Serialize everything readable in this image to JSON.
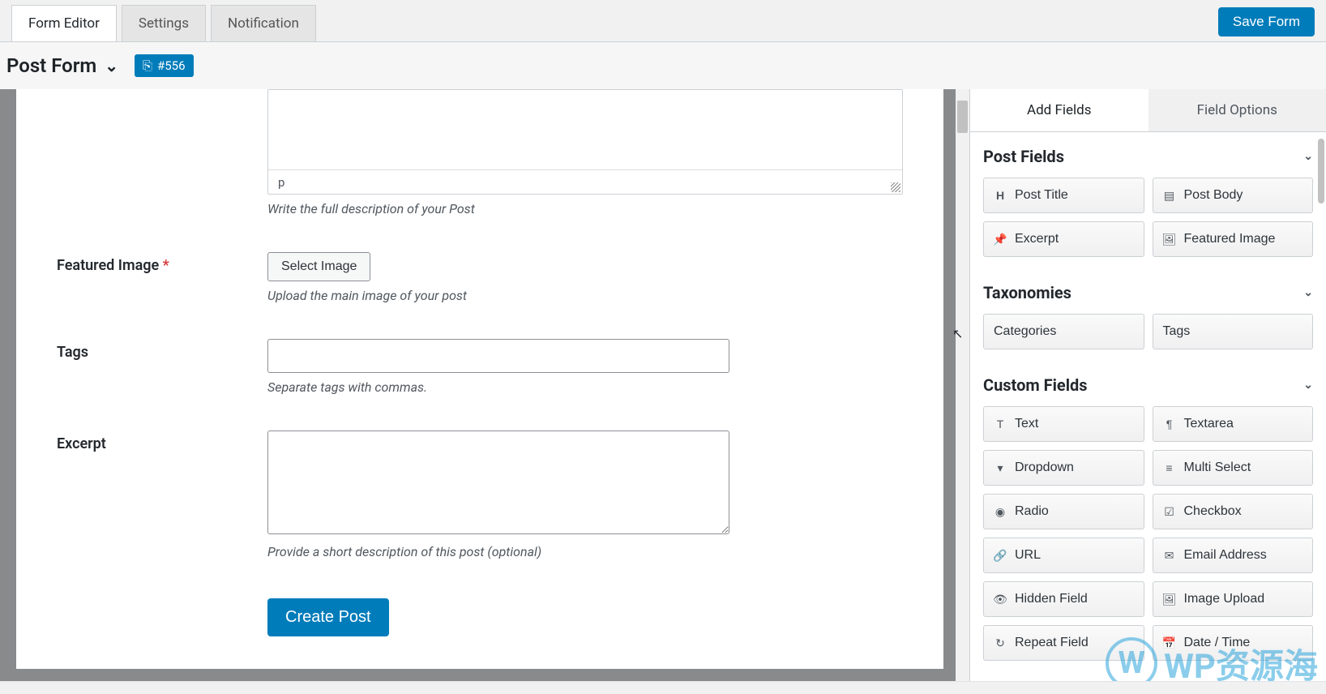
{
  "topbar": {
    "tabs": [
      "Form Editor",
      "Settings",
      "Notification"
    ],
    "save": "Save Form"
  },
  "subbar": {
    "title": "Post Form",
    "badge": "#556"
  },
  "form": {
    "rte_path": "p",
    "rte_help": "Write the full description of your Post",
    "featured": {
      "label": "Featured Image",
      "required": "*",
      "button": "Select Image",
      "help": "Upload the main image of your post"
    },
    "tags": {
      "label": "Tags",
      "help": "Separate tags with commas."
    },
    "excerpt": {
      "label": "Excerpt",
      "help": "Provide a short description of this post (optional)"
    },
    "submit": "Create Post"
  },
  "sidebar": {
    "tabs": [
      "Add Fields",
      "Field Options"
    ],
    "sections": {
      "post": "Post Fields",
      "tax": "Taxonomies",
      "custom": "Custom Fields"
    },
    "post_fields": [
      "Post Title",
      "Post Body",
      "Excerpt",
      "Featured Image"
    ],
    "tax_fields": [
      "Categories",
      "Tags"
    ],
    "custom_fields": [
      "Text",
      "Textarea",
      "Dropdown",
      "Multi Select",
      "Radio",
      "Checkbox",
      "URL",
      "Email Address",
      "Hidden Field",
      "Image Upload",
      "Repeat Field",
      "Date / Time"
    ]
  },
  "watermark": "WP资源海"
}
